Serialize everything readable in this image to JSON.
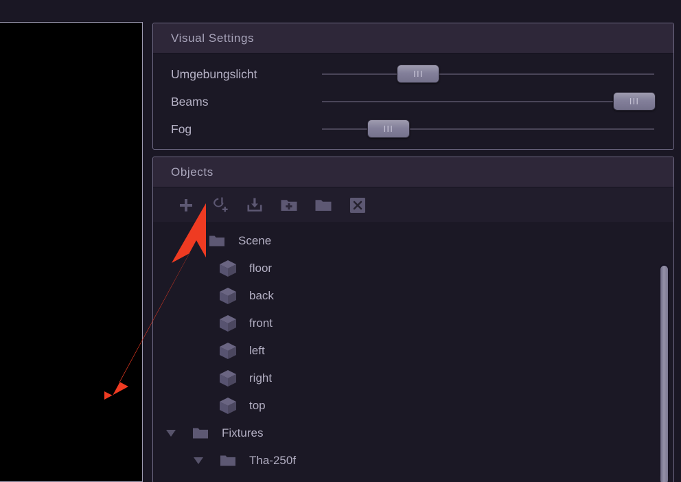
{
  "window": {
    "background_color": "#1a1724",
    "viewport": {
      "name": "3d-viewport",
      "background_color": "#000000"
    }
  },
  "visual_settings": {
    "title": "Visual Settings",
    "sliders": [
      {
        "label": "Umgebungslicht",
        "value_pct": 29,
        "handle_grip": "III"
      },
      {
        "label": "Beams",
        "value_pct": 94,
        "handle_grip": "III"
      },
      {
        "label": "Fog",
        "value_pct": 20,
        "handle_grip": "III"
      }
    ]
  },
  "objects": {
    "title": "Objects",
    "toolbar": [
      {
        "name": "add-object-button",
        "icon": "plus-icon",
        "label": "+"
      },
      {
        "name": "add-fixture-button",
        "icon": "fixture-add-icon",
        "label": ""
      },
      {
        "name": "import-object-button",
        "icon": "import-download-icon",
        "label": ""
      },
      {
        "name": "new-folder-button",
        "icon": "folder-plus-icon",
        "label": ""
      },
      {
        "name": "folder-button",
        "icon": "folder-icon",
        "label": ""
      },
      {
        "name": "delete-button",
        "icon": "close-x-icon",
        "label": "×"
      }
    ],
    "tree": [
      {
        "label": "Scene",
        "icon": "folder-icon",
        "depth": 1,
        "twisty": "none"
      },
      {
        "label": "floor",
        "icon": "cube-icon",
        "depth": 2,
        "twisty": "none"
      },
      {
        "label": "back",
        "icon": "cube-icon",
        "depth": 2,
        "twisty": "none"
      },
      {
        "label": "front",
        "icon": "cube-icon",
        "depth": 2,
        "twisty": "none"
      },
      {
        "label": "left",
        "icon": "cube-icon",
        "depth": 2,
        "twisty": "none"
      },
      {
        "label": "right",
        "icon": "cube-icon",
        "depth": 2,
        "twisty": "none"
      },
      {
        "label": "top",
        "icon": "cube-icon",
        "depth": 2,
        "twisty": "none"
      },
      {
        "label": "Fixtures",
        "icon": "folder-icon",
        "depth": 0,
        "twisty": "expanded"
      },
      {
        "label": "Tha-250f",
        "icon": "folder-icon",
        "depth": 1,
        "twisty": "expanded"
      }
    ],
    "scrollbar": {
      "name": "tree-scrollbar",
      "thumb_position": "top"
    }
  },
  "annotation": {
    "type": "arrow",
    "color": "#ef3b22",
    "points_to": "add-fixture-button"
  }
}
